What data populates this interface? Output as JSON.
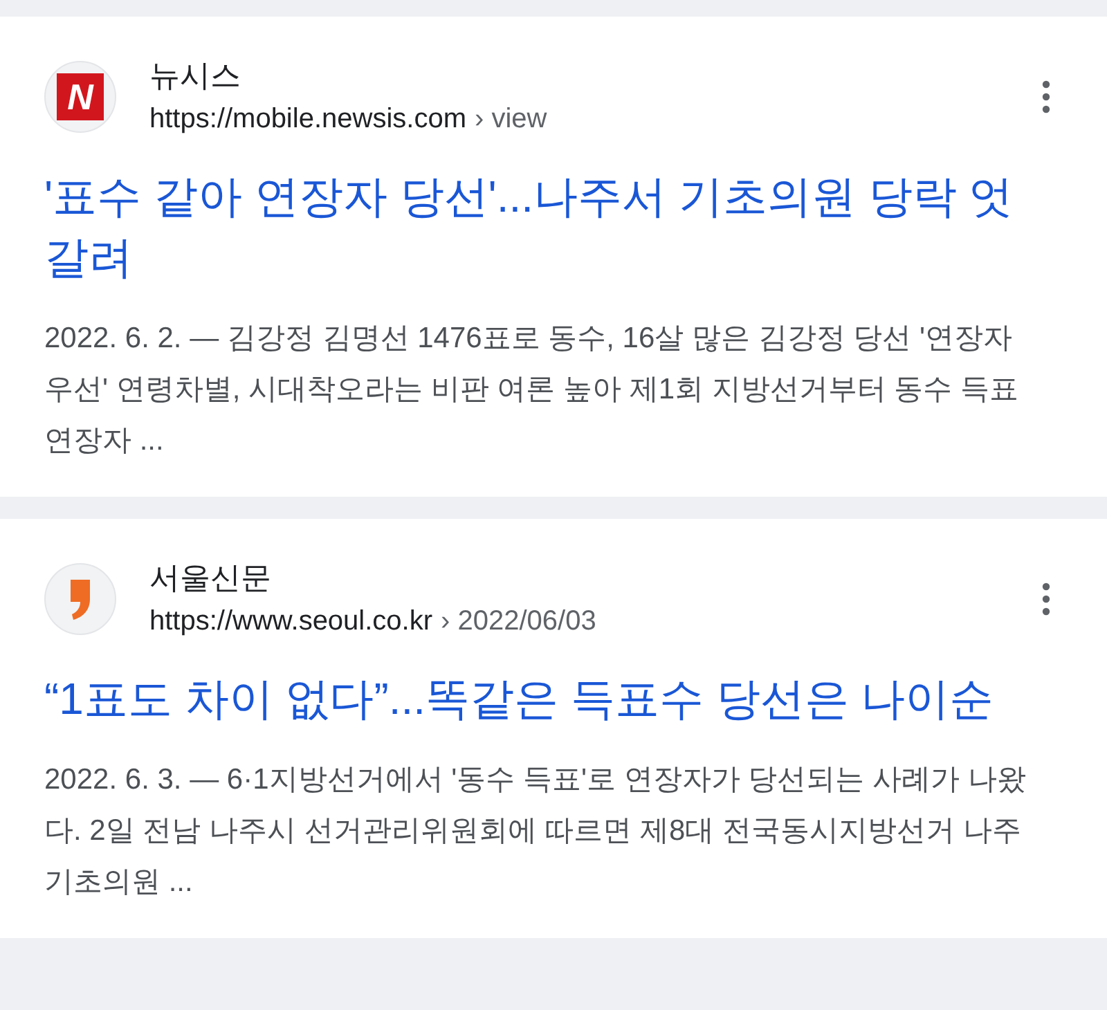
{
  "results": [
    {
      "site": "뉴시스",
      "url": "https://mobile.newsis.com",
      "breadcrumb": "› view",
      "logo": {
        "kind": "letter",
        "text": "N"
      },
      "title": "'표수 같아 연장자 당선'...나주서 기초의원 당락 엇갈려",
      "date": "2022. 6. 2.",
      "dash": "—",
      "snippet": "김강정 김명선 1476표로 동수, 16살 많은 김강정 당선 '연장자 우선' 연령차별, 시대착오라는 비판 여론 높아 제1회 지방선거부터 동수 득표 연장자 ..."
    },
    {
      "site": "서울신문",
      "url": "https://www.seoul.co.kr",
      "breadcrumb": "› 2022/06/03",
      "logo": {
        "kind": "comma"
      },
      "title": "“1표도 차이 없다”...똑같은 득표수 당선은 나이순",
      "date": "2022. 6. 3.",
      "dash": "—",
      "snippet": "6·1지방선거에서 '동수 득표'로 연장자가 당선되는 사례가 나왔다. 2일 전남 나주시 선거관리위원회에 따르면 제8대 전국동시지방선거 나주 기초의원 ..."
    }
  ]
}
